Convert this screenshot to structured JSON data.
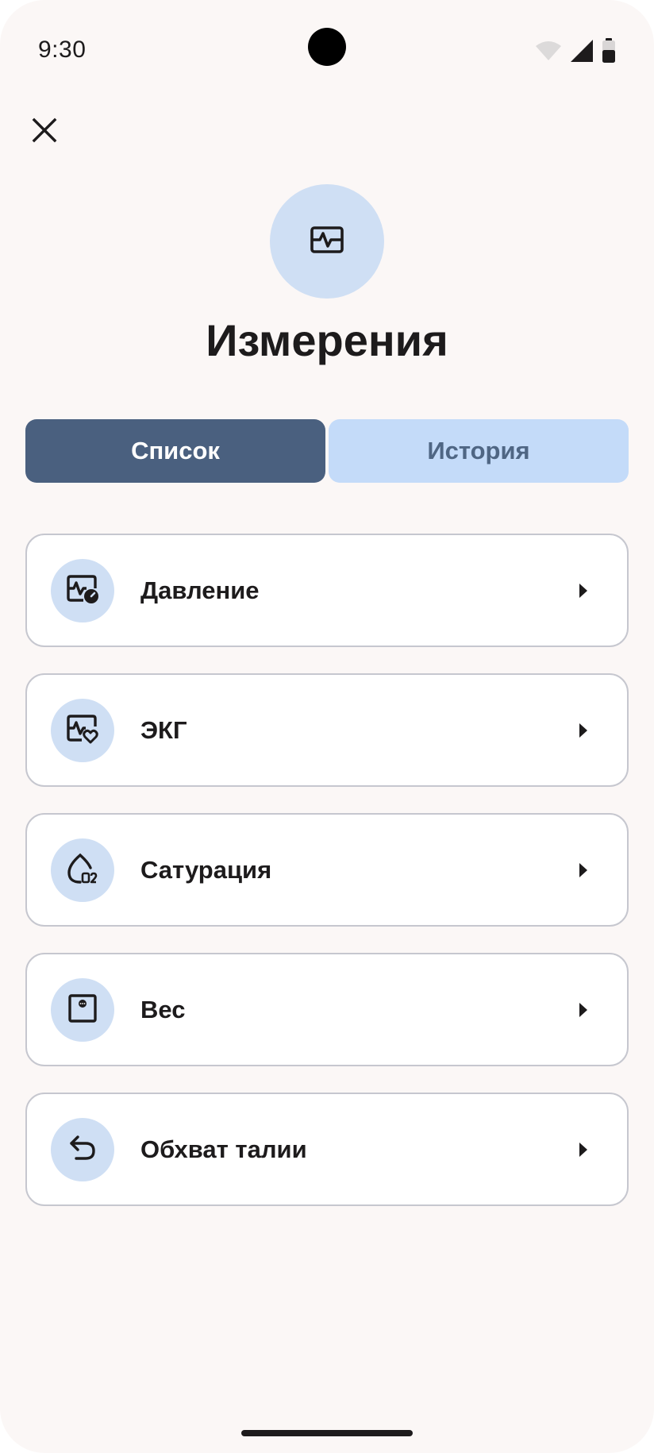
{
  "status_bar": {
    "time": "9:30",
    "icons": [
      "wifi-icon",
      "signal-icon",
      "battery-icon"
    ]
  },
  "header": {
    "close_icon": "close-icon",
    "avatar_icon": "measurements-icon",
    "title": "Измерения"
  },
  "tabs": [
    {
      "label": "Список",
      "active": true
    },
    {
      "label": "История",
      "active": false
    }
  ],
  "measurements": [
    {
      "label": "Давление",
      "icon": "blood-pressure-icon"
    },
    {
      "label": "ЭКГ",
      "icon": "ecg-heart-icon"
    },
    {
      "label": "Сатурация",
      "icon": "oxygen-drop-icon"
    },
    {
      "label": "Вес",
      "icon": "scale-icon"
    },
    {
      "label": "Обхват талии",
      "icon": "undo-arrow-icon"
    }
  ],
  "colors": {
    "background": "#fbf7f6",
    "accent": "#4a607f",
    "tab_inactive": "#c4dbf9",
    "icon_bg": "#cfdff4",
    "card_border": "#c6c7cf",
    "text": "#1d1b1c"
  }
}
